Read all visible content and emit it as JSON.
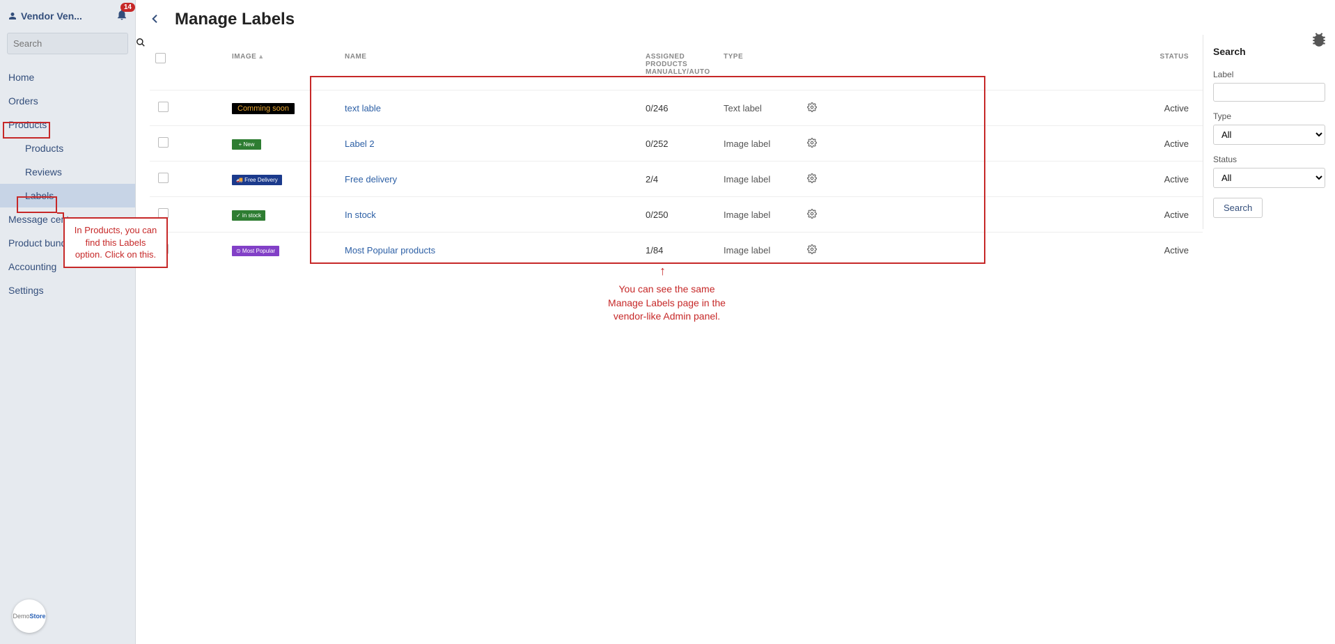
{
  "header": {
    "vendor_name": "Vendor Ven...",
    "notification_count": "14"
  },
  "sidebar": {
    "search_placeholder": "Search",
    "items": {
      "home": "Home",
      "orders": "Orders",
      "products": "Products",
      "products_sub": "Products",
      "reviews": "Reviews",
      "labels": "Labels",
      "message_center": "Message center",
      "product_bundles": "Product bundles",
      "accounting": "Accounting",
      "settings": "Settings"
    },
    "store_badge_demo": "Demo",
    "store_badge_store": "Store"
  },
  "page": {
    "title": "Manage Labels"
  },
  "table": {
    "headers": {
      "image": "IMAGE",
      "name": "NAME",
      "assigned": "ASSIGNED PRODUCTS MANUALLY/AUTO",
      "type": "TYPE",
      "status": "STATUS"
    },
    "rows": [
      {
        "img_text": "Comming soon",
        "img_class": "limg-black",
        "name": "text lable",
        "assigned": "0/246",
        "type": "Text label",
        "status": "Active"
      },
      {
        "img_text": "+  New",
        "img_class": "limg-green",
        "name": "Label 2",
        "assigned": "0/252",
        "type": "Image label",
        "status": "Active"
      },
      {
        "img_text": "🚚 Free Delivery",
        "img_class": "limg-blue",
        "name": "Free delivery",
        "assigned": "2/4",
        "type": "Image label",
        "status": "Active"
      },
      {
        "img_text": "✓  in stock",
        "img_class": "limg-green2",
        "name": "In stock",
        "assigned": "0/250",
        "type": "Image label",
        "status": "Active"
      },
      {
        "img_text": "⊙ Most Popular",
        "img_class": "limg-purple",
        "name": "Most Popular products",
        "assigned": "1/84",
        "type": "Image label",
        "status": "Active"
      }
    ]
  },
  "search_panel": {
    "title": "Search",
    "label_label": "Label",
    "type_label": "Type",
    "type_value": "All",
    "status_label": "Status",
    "status_value": "All",
    "button": "Search"
  },
  "annotations": {
    "products_hint": "In Products, you can find this Labels option. Click on this.",
    "table_hint": "You can see the same Manage Labels page in the vendor-like Admin panel."
  }
}
